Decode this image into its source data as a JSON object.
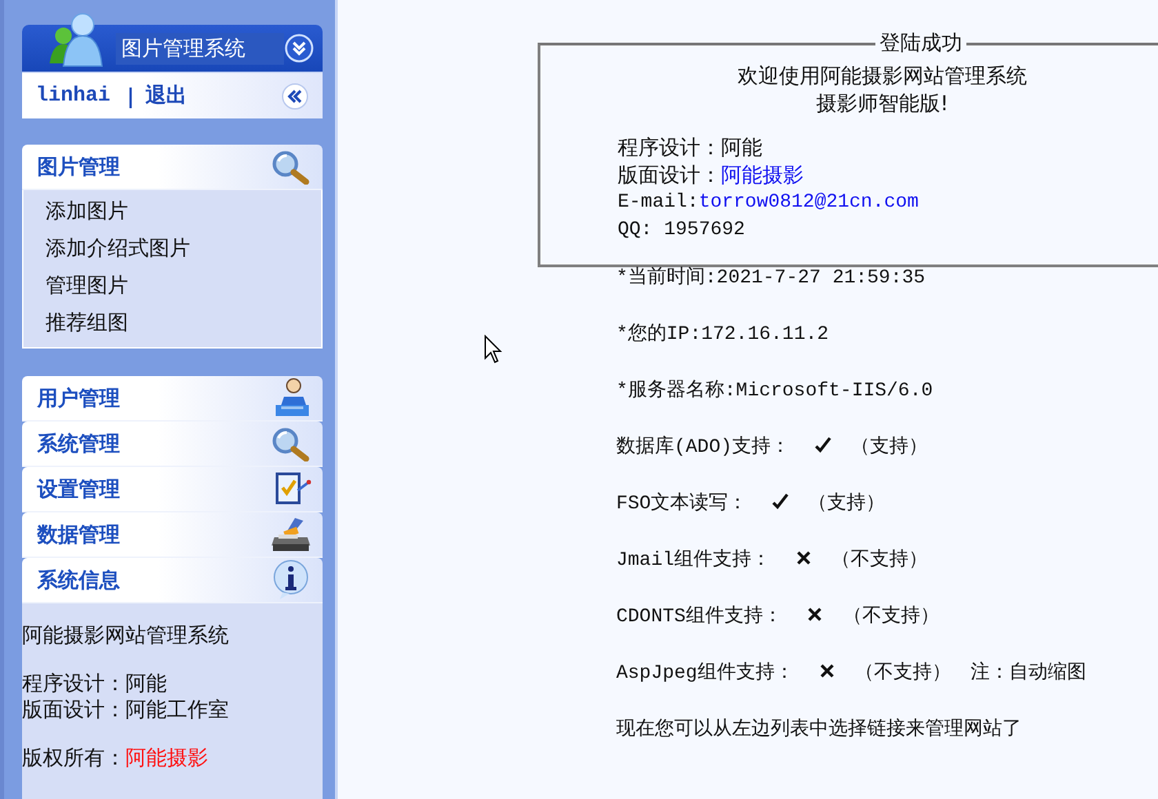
{
  "header": {
    "title": "图片管理系统",
    "user": "linhai",
    "separator": "|",
    "logout": "退出"
  },
  "menus": [
    {
      "title": "图片管理",
      "items": [
        "添加图片",
        "添加介绍式图片",
        "管理图片",
        "推荐组图"
      ]
    },
    {
      "title": "用户管理"
    },
    {
      "title": "系统管理"
    },
    {
      "title": "设置管理"
    },
    {
      "title": "数据管理"
    },
    {
      "title": "系统信息"
    }
  ],
  "about": {
    "name": "阿能摄影网站管理系统",
    "program": "程序设计：阿能",
    "design": "版面设计：阿能工作室",
    "copyright_label": "版权所有：",
    "copyright_link": "阿能摄影"
  },
  "welcome": {
    "legend": "登陆成功",
    "lines": [
      "欢迎使用阿能摄影网站管理系统",
      "摄影师智能版!"
    ],
    "credits": [
      {
        "label": "程序设计：",
        "value": "阿能",
        "link": false
      },
      {
        "label": "版面设计：",
        "value": "阿能摄影",
        "link": true
      },
      {
        "label": "E-mail:",
        "value": "torrow0812@21cn.com",
        "link": true
      },
      {
        "label": "QQ: ",
        "value": "1957692",
        "link": false
      }
    ]
  },
  "info": [
    "*当前时间:2021-7-27 21:59:35",
    "*您的IP:172.16.11.2",
    "*服务器名称:Microsoft-IIS/6.0"
  ],
  "support": [
    {
      "label": "数据库(ADO)支持：",
      "supported": true,
      "status": "（支持）"
    },
    {
      "label": "FSO文本读写：",
      "supported": true,
      "status": "（支持）"
    },
    {
      "label": "Jmail组件支持：",
      "supported": false,
      "status": "（不支持）"
    },
    {
      "label": "CDONTS组件支持：",
      "supported": false,
      "status": "（不支持）"
    },
    {
      "label": "AspJpeg组件支持：",
      "supported": false,
      "status": "（不支持）",
      "note": "注：自动缩图"
    }
  ],
  "footer": "现在您可以从左边列表中选择链接来管理网站了"
}
